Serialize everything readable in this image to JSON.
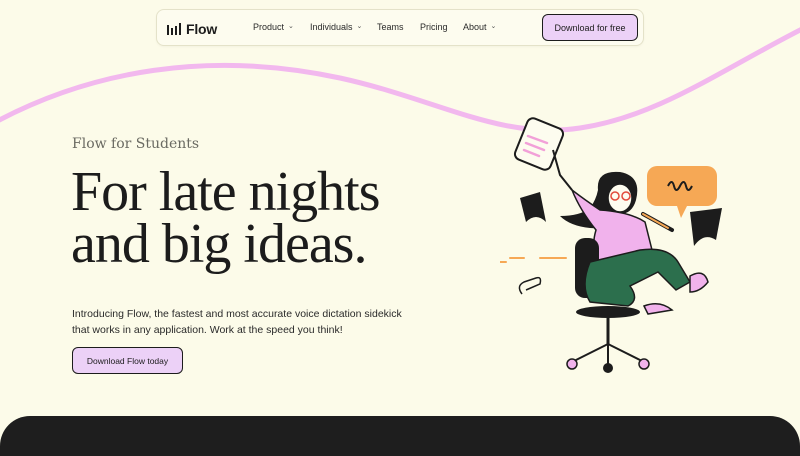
{
  "nav": {
    "brand": "Flow",
    "links": [
      {
        "label": "Product",
        "has_dropdown": true
      },
      {
        "label": "Individuals",
        "has_dropdown": true
      },
      {
        "label": "Teams",
        "has_dropdown": false
      },
      {
        "label": "Pricing",
        "has_dropdown": false
      },
      {
        "label": "About",
        "has_dropdown": true
      }
    ],
    "cta_label": "Download for free",
    "dropdown_glyph": "⌄"
  },
  "hero": {
    "eyebrow": "Flow for Students",
    "headline_line1": "For late nights",
    "headline_line2": "and big ideas.",
    "intro": "Introducing Flow, the fastest and most accurate voice dictation sidekick that works in any application. Work at the speed you think!",
    "cta_label": "Download Flow today"
  },
  "icons": {
    "logo": "audio-bars-icon",
    "dropdown": "chevron-down-icon",
    "illustration": "student-on-office-chair-illustration"
  },
  "colors": {
    "background": "#fcfbe9",
    "accent_pink": "#ecd1f7",
    "wave_pink": "#f2b8ee",
    "speech_bubble": "#f6a855",
    "text": "#1c1c1c",
    "footer_band": "#1e1e1e"
  }
}
